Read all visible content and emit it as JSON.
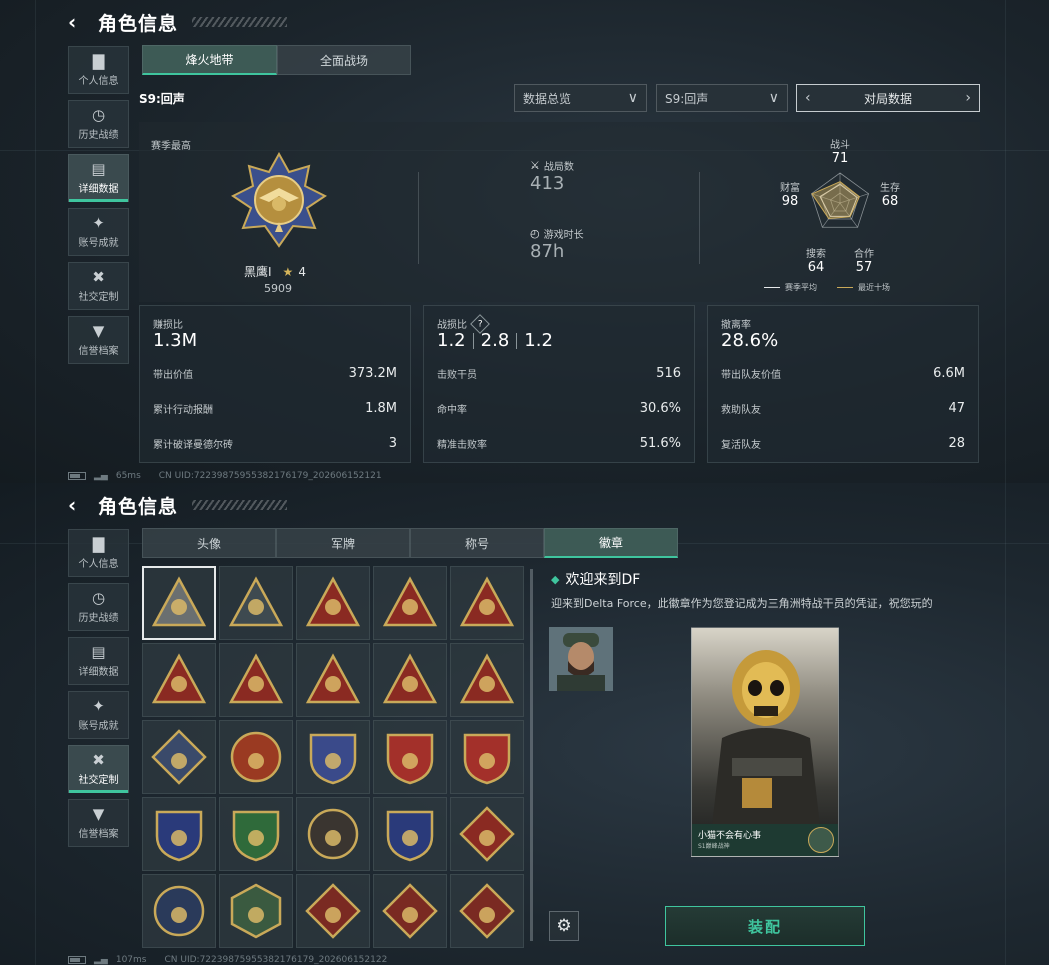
{
  "panel1": {
    "title": "角色信息",
    "sidebar": [
      {
        "label": "个人信息",
        "icon": "bar-chart-icon"
      },
      {
        "label": "历史战绩",
        "icon": "clock-icon"
      },
      {
        "label": "详细数据",
        "icon": "folder-icon"
      },
      {
        "label": "账号成就",
        "icon": "medal-icon"
      },
      {
        "label": "社交定制",
        "icon": "tools-icon"
      },
      {
        "label": "信誉档案",
        "icon": "shield-icon"
      }
    ],
    "active_sidebar": 2,
    "tabs": [
      "烽火地带",
      "全面战场"
    ],
    "season": "S9:回声",
    "dropdowns": {
      "overview": "数据总览",
      "season": "S9:回声",
      "mode": "对局数据"
    },
    "summary": {
      "label": "赛季最高",
      "rank_name": "黑鹰Ⅰ",
      "rank_stars": "4",
      "rank_points": "5909",
      "matches_label": "战局数",
      "matches": "413",
      "time_label": "游戏时长",
      "time": "87h"
    },
    "radar": {
      "combat_label": "战斗",
      "combat": "71",
      "survival_label": "生存",
      "survival": "68",
      "coop_label": "合作",
      "coop": "57",
      "search_label": "搜索",
      "search": "64",
      "wealth_label": "财富",
      "wealth": "98",
      "legend_avg": "赛季平均",
      "legend_recent": "最近十场",
      "values_norm": [
        0.71,
        0.68,
        0.57,
        0.64,
        0.98
      ],
      "avg_norm": [
        0.62,
        0.6,
        0.55,
        0.55,
        0.7
      ],
      "accent": "#c9a959"
    },
    "cards": [
      {
        "title": "赚损比",
        "big": "1.3M",
        "rows": [
          [
            "带出价值",
            "373.2M"
          ],
          [
            "累计行动报酬",
            "1.8M"
          ],
          [
            "累计破译曼德尔砖",
            "3"
          ]
        ]
      },
      {
        "title": "战损比",
        "help": "?",
        "big_parts": [
          "1.2",
          "2.8",
          "1.2"
        ],
        "rows": [
          [
            "击败干员",
            "516"
          ],
          [
            "命中率",
            "30.6%"
          ],
          [
            "精准击败率",
            "51.6%"
          ]
        ]
      },
      {
        "title": "撤离率",
        "big": "28.6%",
        "rows": [
          [
            "带出队友价值",
            "6.6M"
          ],
          [
            "救助队友",
            "47"
          ],
          [
            "复活队友",
            "28"
          ]
        ]
      }
    ],
    "footer": {
      "ping": "65ms",
      "uid": "CN UID:7223987595538217617​9_202606152121"
    }
  },
  "panel2": {
    "title": "角色信息",
    "sidebar": [
      {
        "label": "个人信息",
        "icon": "bar-chart-icon"
      },
      {
        "label": "历史战绩",
        "icon": "clock-icon"
      },
      {
        "label": "详细数据",
        "icon": "folder-icon"
      },
      {
        "label": "账号成就",
        "icon": "medal-icon"
      },
      {
        "label": "社交定制",
        "icon": "tools-icon"
      },
      {
        "label": "信誉档案",
        "icon": "shield-icon"
      }
    ],
    "active_sidebar": 4,
    "tabs": [
      "头像",
      "军牌",
      "称号",
      "徽章"
    ],
    "active_tab": 3,
    "medal_title": "欢迎来到DF",
    "medal_desc": "迎来到Delta Force，此徽章作为您登记成为三角洲特战干员的凭证，祝您玩的",
    "card_name": "小猫不会有心事",
    "card_sub": "S1巅峰战神",
    "equip_label": "装配",
    "footer": {
      "ping": "107ms",
      "uid": "CN UID:7223987595538217617​9_202606152122"
    }
  }
}
